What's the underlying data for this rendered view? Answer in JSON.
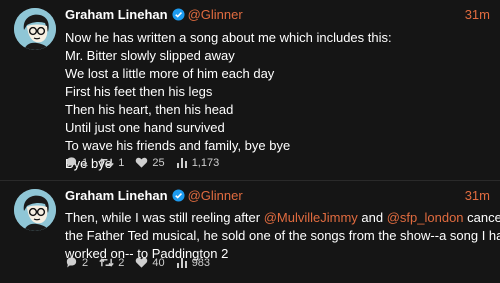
{
  "tweets": [
    {
      "author": "Graham Linehan",
      "handle": "@Glinner",
      "time": "31m",
      "lines": [
        "Now he has written a song about me which includes this:",
        "Mr. Bitter slowly slipped away",
        "We lost a little more of him each day",
        "First his feet then his legs",
        "Then his heart, then his head",
        "Until just one hand survived",
        "To wave his friends and family, bye bye",
        "Bye bye"
      ],
      "stats": {
        "replies": "1",
        "retweets": "1",
        "likes": "25",
        "views": "1,173"
      }
    },
    {
      "author": "Graham Linehan",
      "handle": "@Glinner",
      "time": "31m",
      "text": {
        "p1": "Then, while I was still reeling after ",
        "m1": "@MulvilleJimmy",
        "p2": " and ",
        "m2": "@sfp_london",
        "p3": " cancelled",
        "l2": "the Father Ted musical, he sold one of the songs from the show--a song I had",
        "l3": "worked on-- to Paddington 2"
      },
      "stats": {
        "replies": "2",
        "retweets": "2",
        "likes": "40",
        "views": "983"
      }
    }
  ],
  "colors": {
    "background": "#151515",
    "accent": "#e06b3f",
    "verified": "#1d9bf0",
    "text": "#ffffff",
    "muted": "#cfcfcf"
  },
  "icons": [
    "reply-icon",
    "retweet-icon",
    "heart-icon",
    "stats-icon",
    "verified-icon"
  ]
}
